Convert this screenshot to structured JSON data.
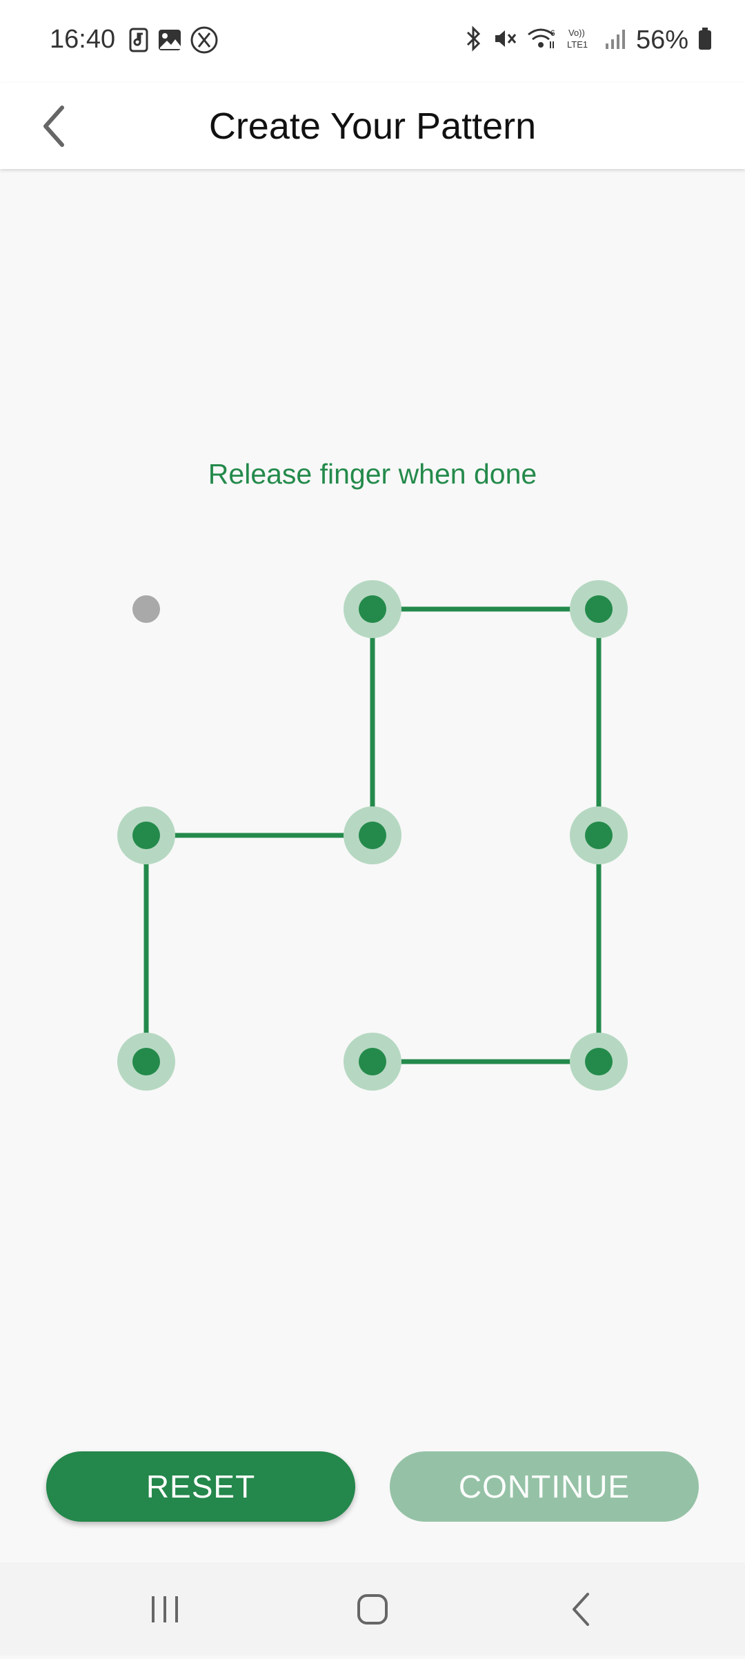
{
  "status_bar": {
    "time": "16:40",
    "battery_percent": "56%",
    "left_icons": [
      "music-phone-icon",
      "image-icon",
      "x-logo-icon"
    ],
    "right_icons": [
      "bluetooth-icon",
      "mute-icon",
      "wifi-icon",
      "volte-icon",
      "signal-icon",
      "battery-icon"
    ],
    "volte_label": "Vo)) LTE1"
  },
  "app_bar": {
    "title": "Create Your Pattern",
    "back_icon": "chevron-left-icon"
  },
  "instruction": "Release finger when done",
  "pattern": {
    "grid": "3x3",
    "selected_sequence": [
      6,
      3,
      4,
      1,
      2,
      5,
      8,
      7
    ],
    "selected_color": "#248a4b",
    "halo_color": "#b6d8c2",
    "unselected_color": "#a9a9a9"
  },
  "buttons": {
    "reset_label": "RESET",
    "continue_label": "CONTINUE"
  },
  "nav_bar": {
    "items": [
      "recents-icon",
      "home-icon",
      "back-icon"
    ]
  },
  "colors": {
    "accent": "#248a4b",
    "continue_disabled": "#95c2a6"
  }
}
